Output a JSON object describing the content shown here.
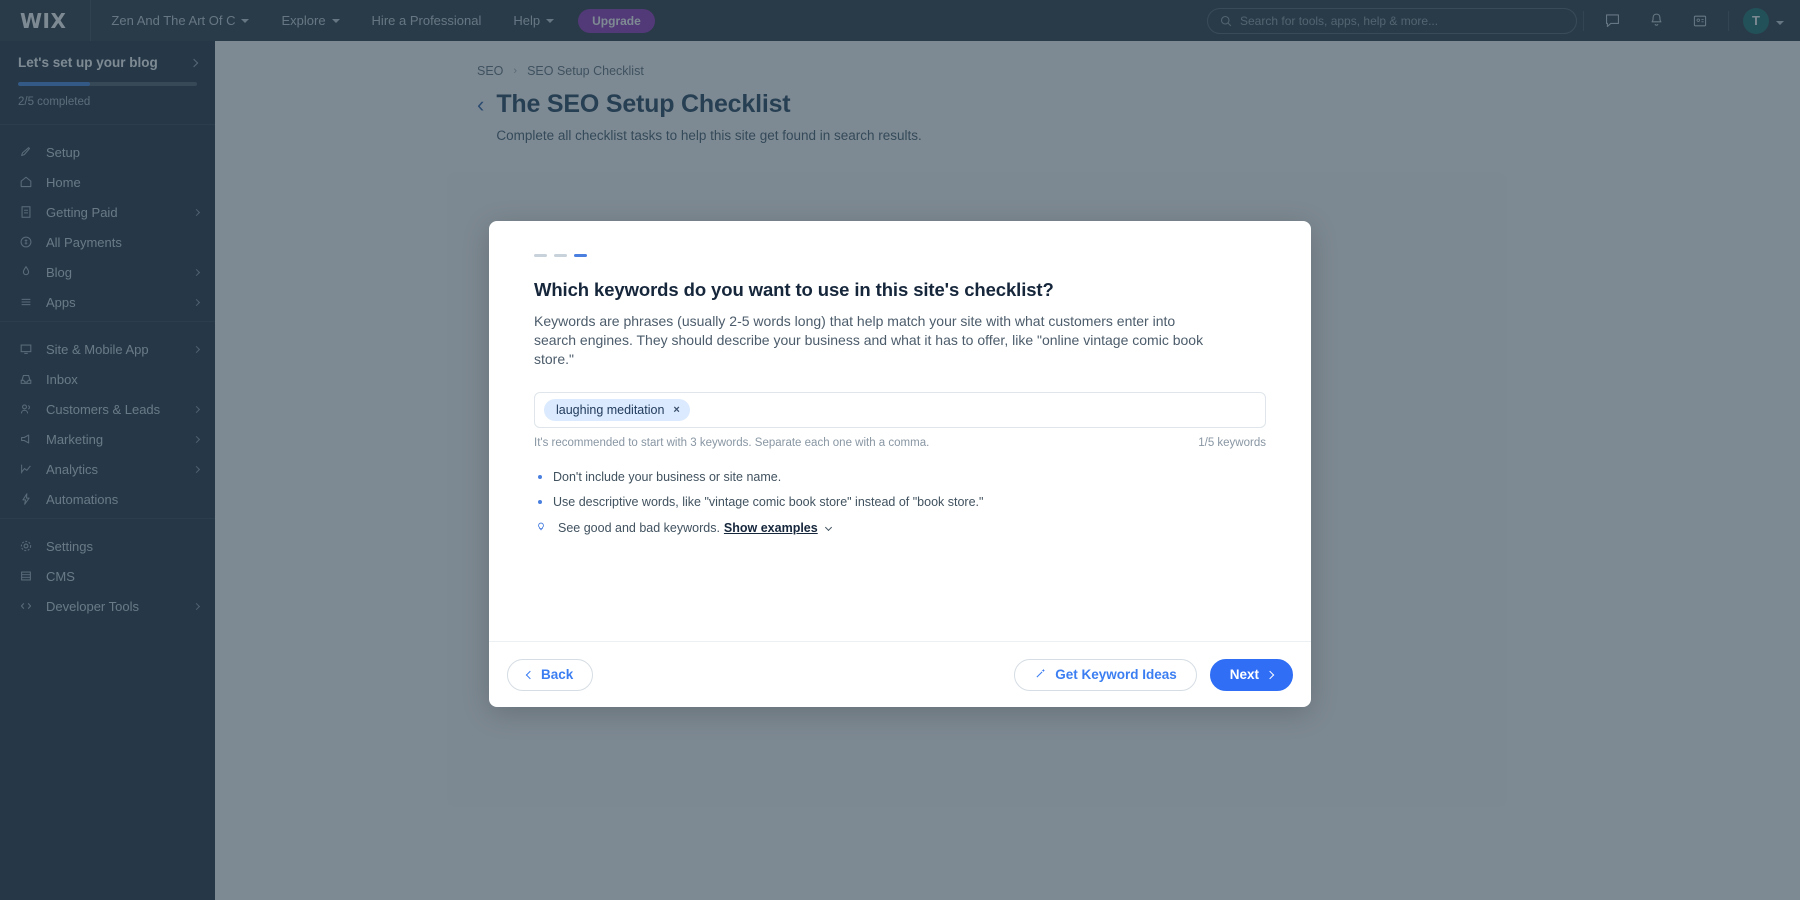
{
  "topbar": {
    "logo": "WIX",
    "site_name": "Zen And The Art Of C",
    "nav": [
      {
        "label": "Explore",
        "has_caret": true
      },
      {
        "label": "Hire a Professional",
        "has_caret": false
      },
      {
        "label": "Help",
        "has_caret": true
      }
    ],
    "upgrade_label": "Upgrade",
    "search_placeholder": "Search for tools, apps, help & more...",
    "icons": [
      "chat-icon",
      "bell-icon",
      "contacts-card-icon"
    ],
    "avatar_initial": "T"
  },
  "sidebar": {
    "setup_title": "Let's set up your blog",
    "progress_percent": 40,
    "progress_label": "2/5 completed",
    "group1": [
      {
        "label": "Setup",
        "icon": "rocket-icon",
        "chevron": false
      },
      {
        "label": "Home",
        "icon": "home-icon",
        "chevron": false
      },
      {
        "label": "Getting Paid",
        "icon": "invoice-icon",
        "chevron": true
      },
      {
        "label": "All Payments",
        "icon": "coin-icon",
        "chevron": false
      },
      {
        "label": "Blog",
        "icon": "pen-icon",
        "chevron": true
      },
      {
        "label": "Apps",
        "icon": "apps-icon",
        "chevron": true
      }
    ],
    "group2": [
      {
        "label": "Site & Mobile App",
        "icon": "monitor-icon",
        "chevron": true
      },
      {
        "label": "Inbox",
        "icon": "inbox-icon",
        "chevron": false
      },
      {
        "label": "Customers & Leads",
        "icon": "people-icon",
        "chevron": true
      },
      {
        "label": "Marketing",
        "icon": "megaphone-icon",
        "chevron": true
      },
      {
        "label": "Analytics",
        "icon": "chart-icon",
        "chevron": true
      },
      {
        "label": "Automations",
        "icon": "bolt-icon",
        "chevron": false
      }
    ],
    "group3": [
      {
        "label": "Settings",
        "icon": "gear-icon",
        "chevron": false
      },
      {
        "label": "CMS",
        "icon": "database-icon",
        "chevron": false
      },
      {
        "label": "Developer Tools",
        "icon": "code-icon",
        "chevron": true
      }
    ]
  },
  "page": {
    "breadcrumb": [
      "SEO",
      "SEO Setup Checklist"
    ],
    "title": "The SEO Setup Checklist",
    "subtitle": "Complete all checklist tasks to help this site get found in search results."
  },
  "modal": {
    "steps_total": 3,
    "step_active": 3,
    "title": "Which keywords do you want to use in this site's checklist?",
    "description": "Keywords are phrases (usually 2-5 words long) that help match your site with what customers enter into search engines. They should describe your business and what it has to offer, like \"online vintage comic book store.\"",
    "keywords": [
      {
        "label": "laughing meditation",
        "remove": "×"
      }
    ],
    "hint_left": "It's recommended to start with 3 keywords. Separate each one with a comma.",
    "hint_right": "1/5 keywords",
    "tips": [
      "Don't include your business or site name.",
      "Use descriptive words, like \"vintage comic book store\" instead of \"book store.\""
    ],
    "examples_text": "See good and bad keywords.",
    "examples_link": "Show examples",
    "footer": {
      "back_label": "Back",
      "keyword_ideas_label": "Get Keyword Ideas",
      "next_label": "Next"
    }
  },
  "colors": {
    "accent_blue": "#2f6ef5",
    "sidebar_bg": "#18293a",
    "topbar_bg": "#20303c",
    "upgrade_purple": "#8c2ab5",
    "avatar_green": "#116a67",
    "tag_blue": "#dbeafe"
  }
}
